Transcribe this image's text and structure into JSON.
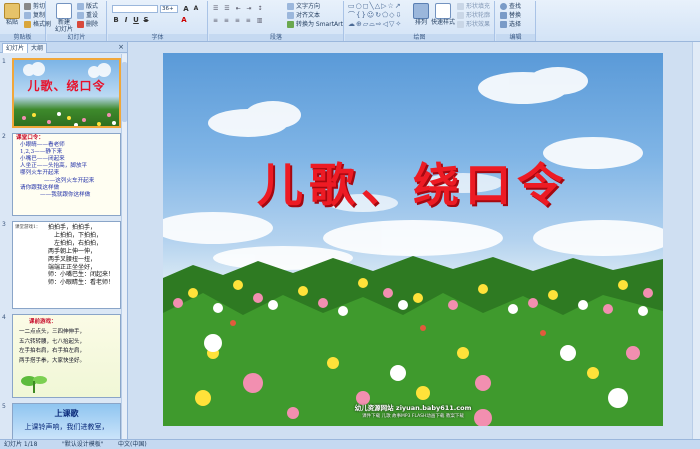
{
  "ribbon": {
    "clipboard": {
      "paste": "粘贴",
      "cut": "剪切",
      "copy": "复制",
      "format_painter": "格式刷",
      "label": "剪贴板"
    },
    "slides": {
      "new_slide": "新建\n幻灯片",
      "layout": "版式",
      "reset": "重设",
      "delete": "删除",
      "label": "幻灯片"
    },
    "font": {
      "size": "36+",
      "label": "字体"
    },
    "paragraph": {
      "text_direction": "文字方向",
      "align_text": "对齐文本",
      "smartart": "转换为 SmartArt",
      "label": "段落"
    },
    "drawing": {
      "arrange": "排列",
      "quick_styles": "快速样式",
      "shape_fill": "形状填充",
      "shape_outline": "形状轮廓",
      "shape_effects": "形状效果",
      "label": "绘图"
    },
    "editing": {
      "find": "查找",
      "replace": "替换",
      "select": "选择",
      "label": "编辑"
    }
  },
  "panel": {
    "tab_slides": "幻灯片",
    "tab_outline": "大纲",
    "close": "×"
  },
  "thumbnails": [
    {
      "num": "1",
      "title": "儿歌、绕口令"
    },
    {
      "num": "2",
      "lines": [
        "课堂口令：",
        "小眼睛——看老师",
        "1,2,3——静下来",
        "小嘴巴——闭起来",
        "人坐正——头抬高，脚放平",
        "哪列火车开起来",
        "——这列火车开起来",
        "请你跟我这样做",
        "——我就跟你这样做"
      ]
    },
    {
      "num": "3",
      "label": "课堂游戏1：",
      "lines": [
        "拍拍手，拍拍手，",
        "上拍拍，下拍拍，",
        "左拍拍，右拍拍，",
        "两手朝上伸一伸，",
        "两手叉腰扭一扭，",
        "端端正正坐坐好，",
        "师：小嘴巴生：闭起来！",
        "师：小眼睛生：看老师！"
      ]
    },
    {
      "num": "4",
      "lines": [
        "课前游戏：",
        "一二点点头，三四伸伸手，",
        "五六转转腰，七八抬起头，",
        "左手拍右肩，右手拍左肩，",
        "两手搭手拳，大家快坐好。"
      ]
    },
    {
      "num": "5",
      "lines": [
        "上课歌",
        "上课铃声响，我们进教室，"
      ]
    }
  ],
  "slide": {
    "title": "儿歌、绕口令",
    "watermark": "幼儿资源网站 ziyuan.baby611.com",
    "watermark_sub": "课件下载  儿歌  故事MP3  FLASH动画下载  教案下载"
  },
  "status": {
    "slide_index": "幻灯片 1/18",
    "theme": "\"默认设计模板\"",
    "lang": "中文(中国)"
  },
  "colors": {
    "title": "#ed1b24",
    "ribbon": "#d3e3f6",
    "select": "#f1a73a"
  }
}
